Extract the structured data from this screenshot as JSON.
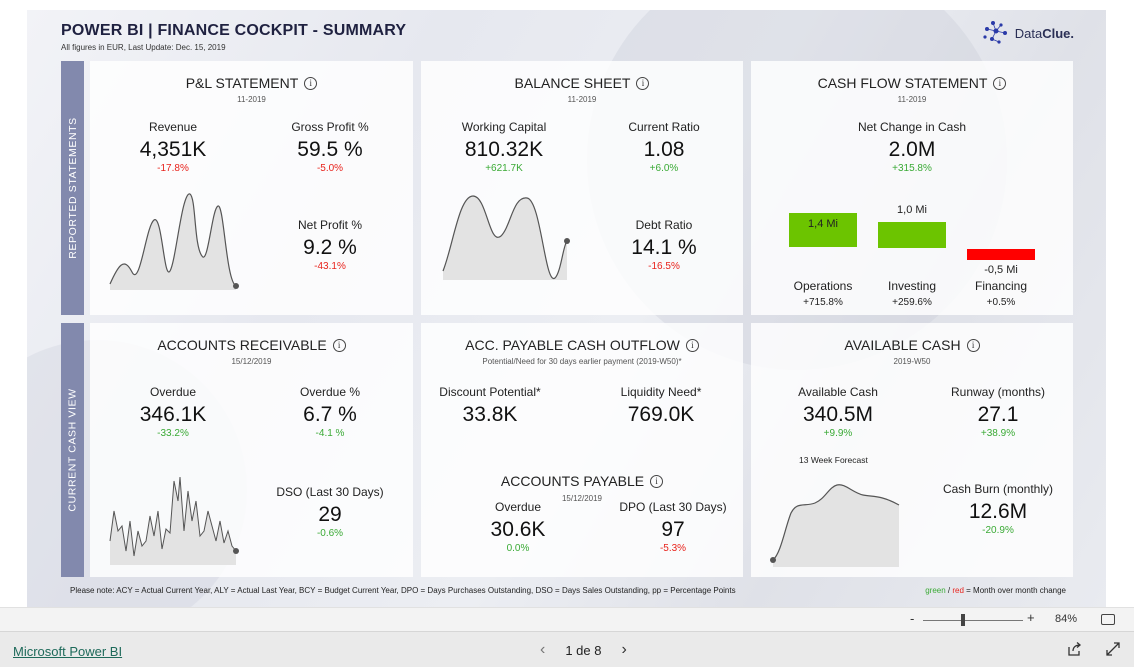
{
  "header": {
    "title": "POWER BI   |   FINANCE COCKPIT - SUMMARY",
    "subtitle": "All figures in EUR, Last Update: Dec. 15, 2019",
    "logo_text_a": "Data",
    "logo_text_b": "Clue."
  },
  "bands": {
    "top": "REPORTED STATEMENTS",
    "bottom": "CURRENT CASH VIEW"
  },
  "pl": {
    "title": "P&L STATEMENT",
    "period": "11-2019",
    "revenue": {
      "label": "Revenue",
      "value": "4,351K",
      "change": "-17.8%"
    },
    "gross_profit": {
      "label": "Gross Profit %",
      "value": "59.5 %",
      "change": "-5.0%"
    },
    "net_profit": {
      "label": "Net Profit %",
      "value": "9.2 %",
      "change": "-43.1%"
    }
  },
  "balance": {
    "title": "BALANCE SHEET",
    "period": "11-2019",
    "working_capital": {
      "label": "Working Capital",
      "value": "810.32K",
      "change": "+621.7K"
    },
    "current_ratio": {
      "label": "Current Ratio",
      "value": "1.08",
      "change": "+6.0%"
    },
    "debt_ratio": {
      "label": "Debt Ratio",
      "value": "14.1 %",
      "change": "-16.5%"
    }
  },
  "cashflow": {
    "title": "CASH FLOW STATEMENT",
    "period": "11-2019",
    "net_change": {
      "label": "Net Change in Cash",
      "value": "2.0M",
      "change": "+315.8%"
    },
    "bars": [
      {
        "name": "Operations",
        "value_label": "1,4 Mi",
        "change": "+715.8%",
        "value": 1.4,
        "color": "#6cc400"
      },
      {
        "name": "Investing",
        "value_label": "1,0 Mi",
        "change": "+259.6%",
        "value": 1.0,
        "color": "#6cc400"
      },
      {
        "name": "Financing",
        "value_label": "-0,5 Mi",
        "change": "+0.5%",
        "value": -0.5,
        "color": "#ff0000"
      }
    ]
  },
  "ar": {
    "title": "ACCOUNTS RECEIVABLE",
    "date": "15/12/2019",
    "overdue": {
      "label": "Overdue",
      "value": "346.1K",
      "change": "-33.2%"
    },
    "overdue_pct": {
      "label": "Overdue %",
      "value": "6.7 %",
      "change": "-4.1 %"
    },
    "dso": {
      "label": "DSO (Last 30 Days)",
      "value": "29",
      "change": "-0.6%"
    }
  },
  "ap_outflow": {
    "title": "ACC. PAYABLE CASH OUTFLOW",
    "subtitle": "Potential/Need for 30 days earlier payment (2019-W50)*",
    "discount": {
      "label": "Discount Potential*",
      "value": "33.8K"
    },
    "liquidity": {
      "label": "Liquidity Need*",
      "value": "769.0K"
    }
  },
  "ap": {
    "title": "ACCOUNTS PAYABLE",
    "date": "15/12/2019",
    "overdue": {
      "label": "Overdue",
      "value": "30.6K",
      "change": "0.0%"
    },
    "dpo": {
      "label": "DPO (Last 30 Days)",
      "value": "97",
      "change": "-5.3%"
    }
  },
  "cash": {
    "title": "AVAILABLE CASH",
    "period": "2019-W50",
    "available": {
      "label": "Available Cash",
      "value": "340.5M",
      "change": "+9.9%"
    },
    "forecast_label": "13 Week Forecast",
    "runway": {
      "label": "Runway (months)",
      "value": "27.1",
      "change": "+38.9%"
    },
    "burn": {
      "label": "Cash Burn (monthly)",
      "value": "12.6M",
      "change": "-20.9%"
    }
  },
  "footnote": "Please note: ACY = Actual Current Year, ALY = Actual Last Year, BCY = Budget Current Year, DPO = Days Purchases Outstanding, DSO = Days Sales Outstanding, pp = Percentage Points",
  "legend_note": {
    "green": "green",
    "sep": " / ",
    "red": "red",
    "rest": " = Month over month change"
  },
  "zoom": {
    "minus": "-",
    "plus": "+",
    "percent": "84%"
  },
  "footer": {
    "link": "Microsoft Power BI",
    "page_label": "1 de 8"
  },
  "colors": {
    "positive": "#3aaa35",
    "negative": "#e8231c",
    "band": "#8289ad"
  }
}
